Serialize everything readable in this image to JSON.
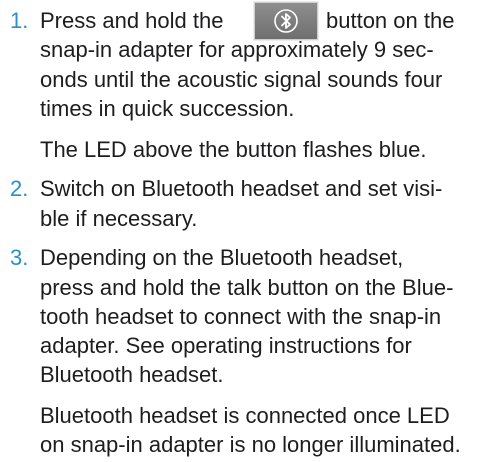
{
  "steps": [
    {
      "number": "1.",
      "lines": [
        "Press and hold the",
        "button on the",
        "snap-in adapter for approximately 9 sec-",
        "onds until the acoustic signal sounds four",
        "times in quick succession."
      ],
      "result": [
        "The LED above the button flashes blue."
      ]
    },
    {
      "number": "2.",
      "lines": [
        "Switch on Bluetooth headset and set visi-",
        "ble if necessary."
      ]
    },
    {
      "number": "3.",
      "lines": [
        "Depending on the Bluetooth headset,",
        "press and hold the talk button on the Blue-",
        "tooth headset to connect with the snap-in",
        "adapter. See operating instructions for",
        "Bluetooth headset."
      ],
      "result": [
        "Bluetooth headset is connected once LED",
        "on snap-in adapter is no longer illuminated."
      ]
    }
  ],
  "icon": "bluetooth-icon",
  "colors": {
    "accent": "#2a8fc8",
    "text": "#1d1d1f",
    "button": "#7a7a7a"
  }
}
